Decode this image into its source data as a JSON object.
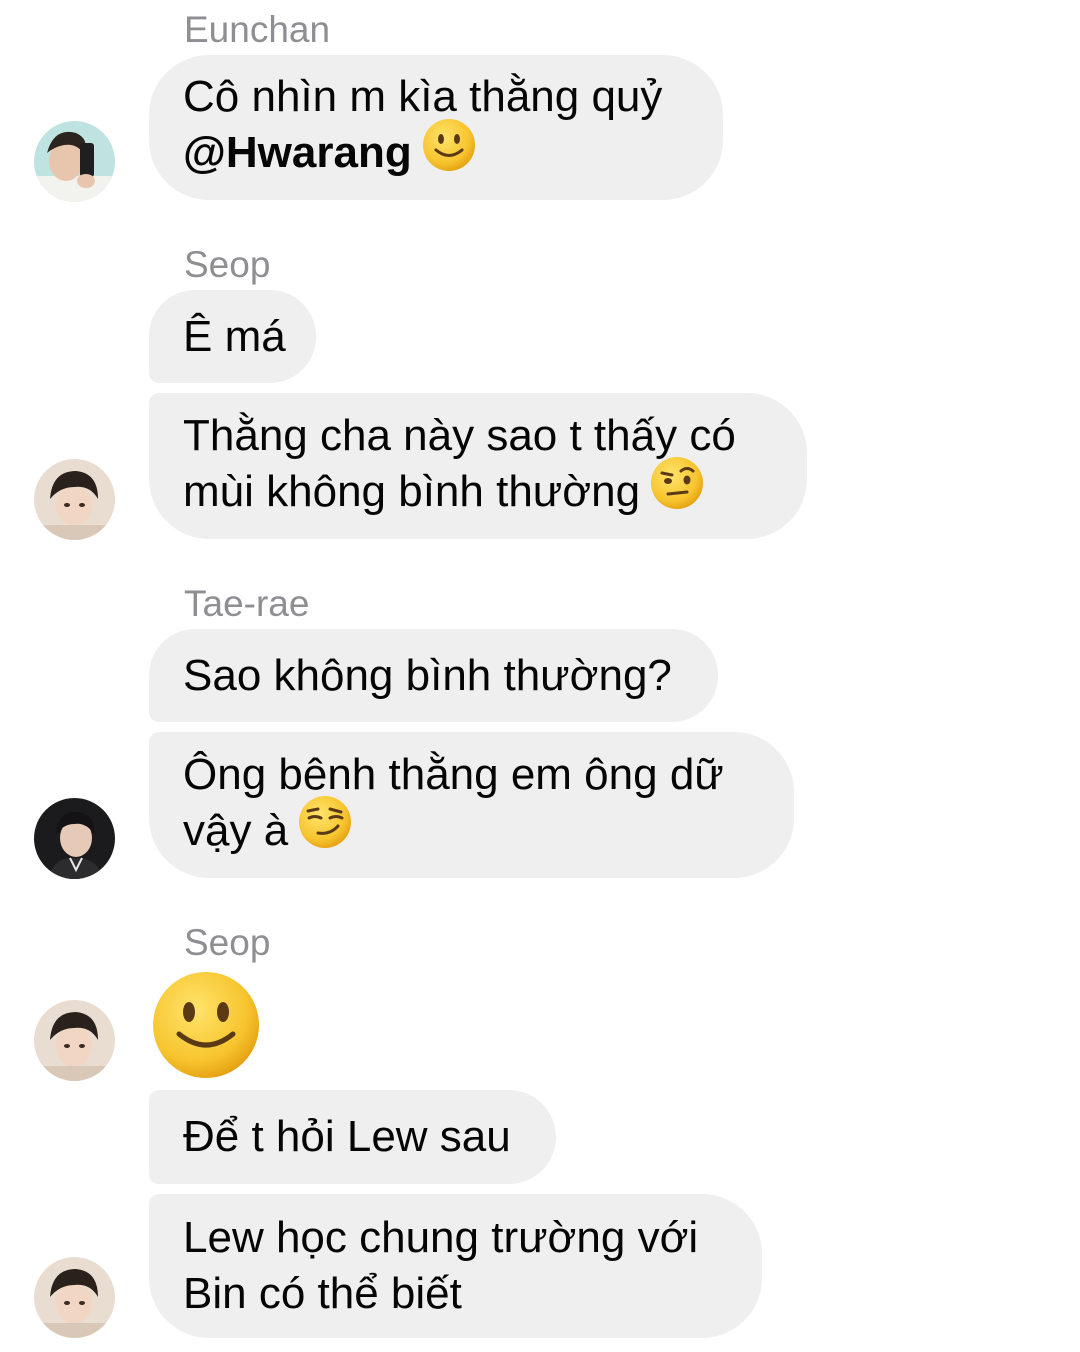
{
  "messages": [
    {
      "sender": "Eunchan",
      "bubbles": [
        {
          "line1_prefix": "Cô nhìn m kìa thằng quỷ",
          "mention": "@Hwarang",
          "emoji": "slightly-smiling-face"
        }
      ]
    },
    {
      "sender": "Seop",
      "bubbles": [
        {
          "text": "Ê má"
        },
        {
          "line1": "Thằng cha này sao t thấy có",
          "line2": "mùi không bình thường",
          "emoji": "face-with-raised-eyebrow"
        }
      ]
    },
    {
      "sender": "Tae-rae",
      "bubbles": [
        {
          "text": "Sao không bình thường?"
        },
        {
          "line1": "Ông bênh thằng em ông dữ",
          "line2": "vậy à",
          "emoji": "smirking-face"
        }
      ]
    },
    {
      "sender": "Seop",
      "bubbles": [
        {
          "emoji": "slightly-smiling-face"
        },
        {
          "text": "Để t hỏi Lew sau"
        },
        {
          "line1": "Lew học chung trường với",
          "line2": "Bin có thể biết"
        }
      ]
    }
  ],
  "colors": {
    "bubble_bg": "#efefef",
    "sender_text": "#8e8e93",
    "message_text": "#050505",
    "emoji_yellow": "#f7c42e"
  }
}
